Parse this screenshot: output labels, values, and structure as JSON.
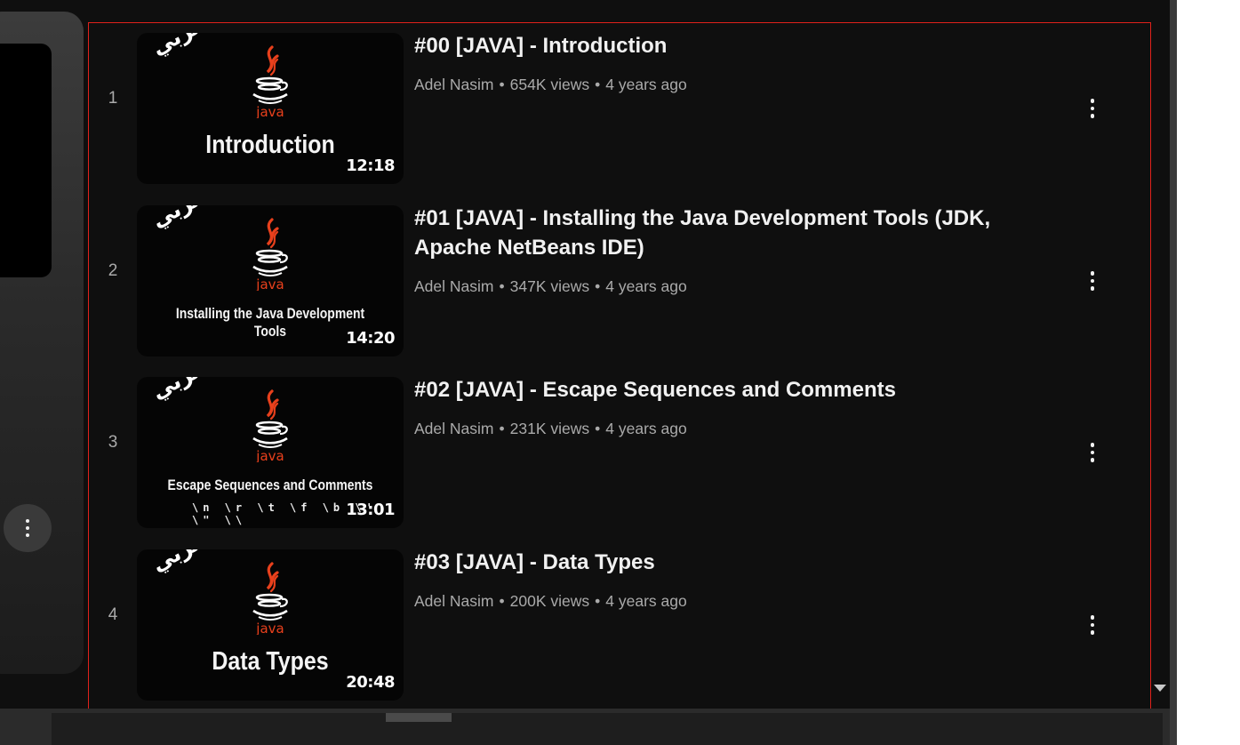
{
  "playlist": {
    "items": [
      {
        "index": "1",
        "title": "#00 [JAVA] - Introduction",
        "channel": "Adel Nasim",
        "views": "654K views",
        "age": "4 years ago",
        "duration": "12:18",
        "thumb_badge": "بالعربي",
        "thumb_logo_text": "java",
        "thumb_title": "Introduction"
      },
      {
        "index": "2",
        "title": "#01 [JAVA] - Installing the Java Development Tools (JDK, Apache NetBeans IDE)",
        "channel": "Adel Nasim",
        "views": "347K views",
        "age": "4 years ago",
        "duration": "14:20",
        "thumb_badge": "بالعربي",
        "thumb_logo_text": "java",
        "thumb_title": "Installing the Java Development Tools"
      },
      {
        "index": "3",
        "title": "#02 [JAVA] - Escape Sequences and Comments",
        "channel": "Adel Nasim",
        "views": "231K views",
        "age": "4 years ago",
        "duration": "13:01",
        "thumb_badge": "بالعربي",
        "thumb_logo_text": "java",
        "thumb_title": "Escape Sequences and Comments",
        "thumb_subtitle": "\\n \\r \\t \\f \\b \\' \\\" \\\\"
      },
      {
        "index": "4",
        "title": "#03 [JAVA] - Data Types",
        "channel": "Adel Nasim",
        "views": "200K views",
        "age": "4 years ago",
        "duration": "20:48",
        "thumb_badge": "بالعربي",
        "thumb_logo_text": "java",
        "thumb_title": "Data Types"
      }
    ]
  },
  "meta_separator": "•",
  "icons": {
    "row_menu": "more-vert-icon",
    "panel_menu": "more-vert-icon",
    "scroll": "caret-down-icon",
    "logo": "java-logo-icon"
  },
  "colors": {
    "background": "#0f0f0f",
    "title": "#f1f1f1",
    "meta": "#aaaaaa",
    "highlight_border": "#e0211b",
    "java_red": "#e8401c"
  }
}
